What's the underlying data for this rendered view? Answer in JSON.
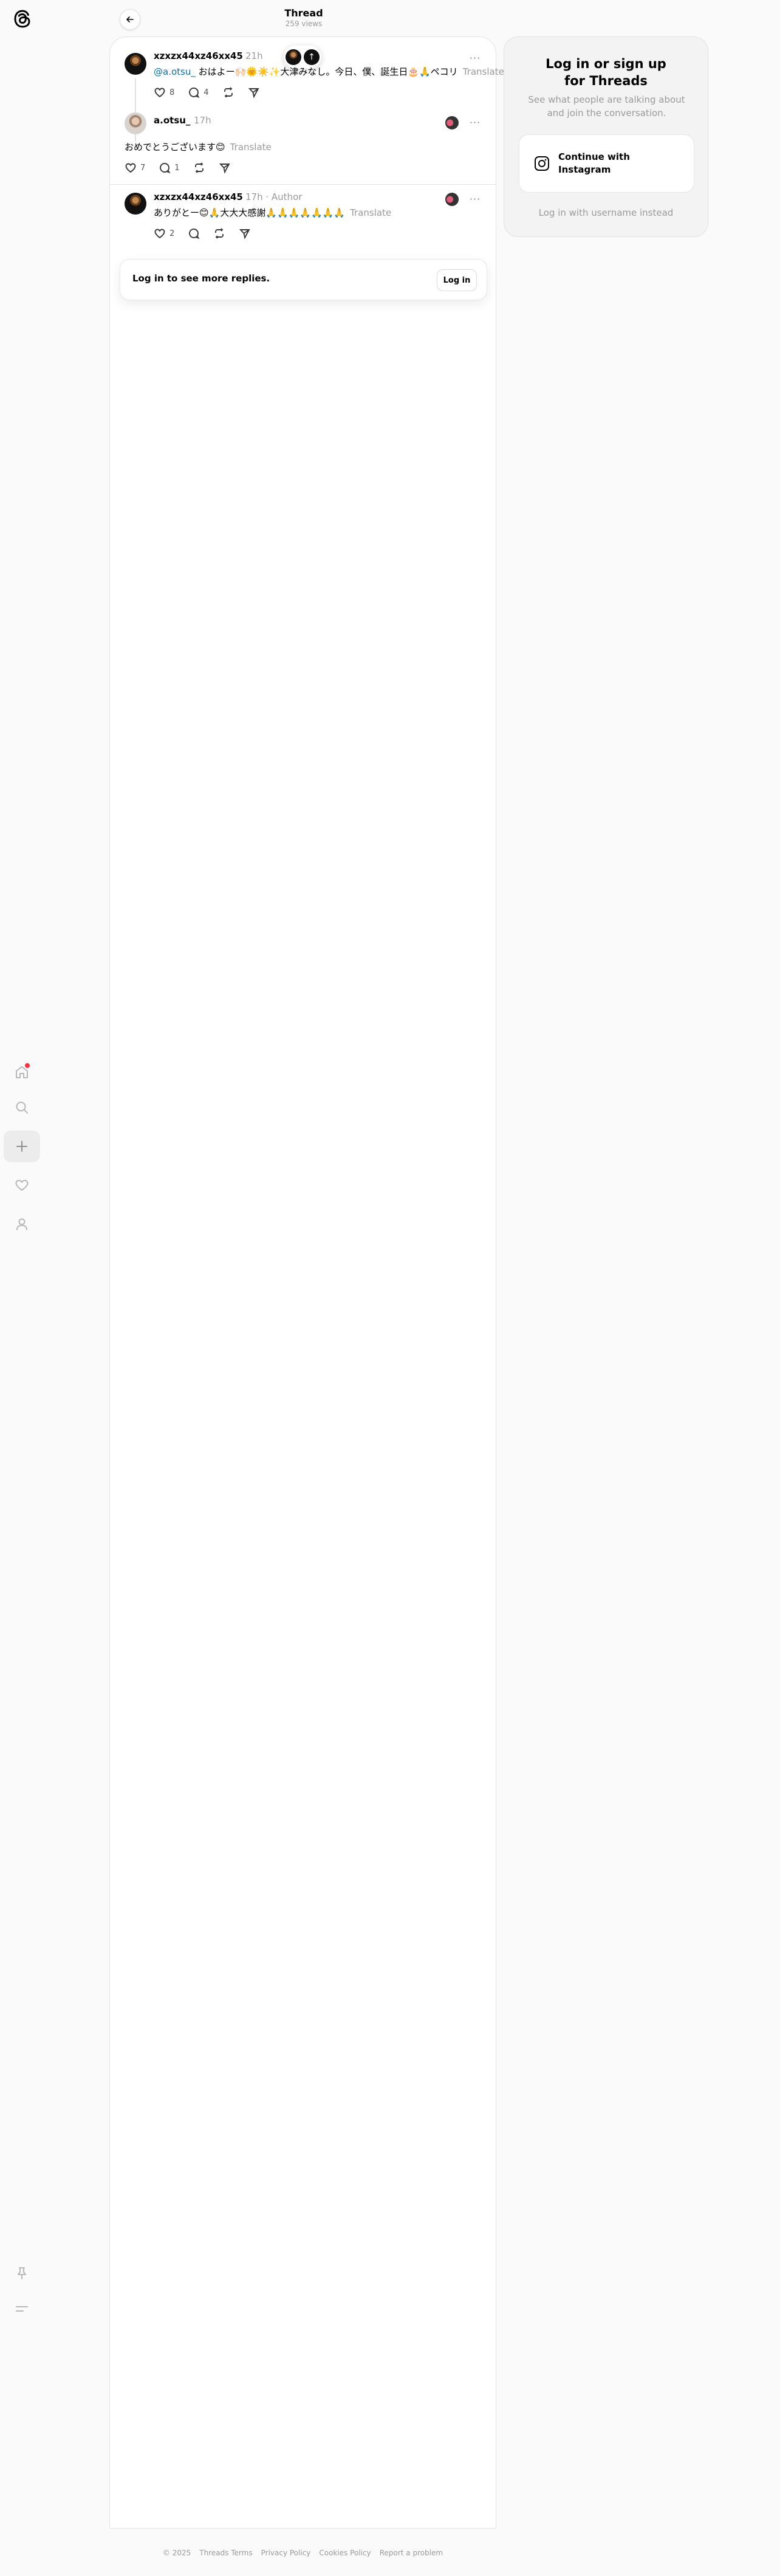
{
  "header": {
    "title": "Thread",
    "views": "259 views"
  },
  "nav": {
    "items": [
      "home-icon",
      "search-icon",
      "create-icon",
      "heart-icon",
      "profile-icon"
    ],
    "bottom": [
      "pin-icon",
      "menu-icon"
    ],
    "notification_color": "#ff3040"
  },
  "posts": [
    {
      "username": "xzxzx44xz46xx45",
      "time": "21h",
      "mention": "@a.otsu_",
      "text": " おはよー🙌🏻🌞☀️✨大津みなし。今日、僕、誕生日🎂🙏ペコリ",
      "translate": "Translate",
      "likes": "8",
      "replies": "4"
    },
    {
      "username": "a.otsu_",
      "time": "17h",
      "text": "おめでとうございます😊",
      "translate": "Translate",
      "likes": "7",
      "replies": "1"
    },
    {
      "username": "xzxzx44xz46xx45",
      "time": "17h",
      "author": "Author",
      "text": "ありがとー😊🙏大大大感謝🙏🙏🙏🙏🙏🙏🙏",
      "translate": "Translate",
      "likes": "2",
      "replies": ""
    }
  ],
  "login_prompt": {
    "text": "Log in to see more replies.",
    "button": "Log in"
  },
  "side_panel": {
    "title": "Log in or sign up for Threads",
    "subtitle": "See what people are talking about and join the conversation.",
    "instagram_button": "Continue with Instagram",
    "username_link": "Log in with username instead"
  },
  "footer": {
    "items": [
      "© 2025",
      "Threads Terms",
      "Privacy Policy",
      "Cookies Policy",
      "Report a problem"
    ]
  },
  "colors": {
    "accent_link": "#0a71a8",
    "background": "#fafafa"
  }
}
